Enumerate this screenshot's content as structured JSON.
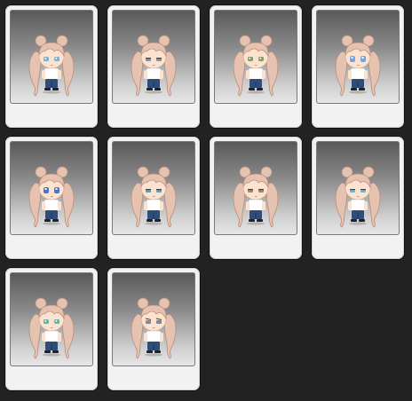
{
  "colors": {
    "background": "#222222",
    "card": "#f2f2f2",
    "hair": "#e6c2b1",
    "hair_shade": "#b88d7c",
    "skin": "#fde3cf",
    "shirt": "#ffffff",
    "pants": "#2f4d7a"
  },
  "faces": [
    {
      "eyes": "#7ab5c9",
      "expression": "neutral"
    },
    {
      "eyes": "#7f95a6",
      "expression": "half-closed"
    },
    {
      "eyes": "#8a9a6e",
      "expression": "neutral"
    },
    {
      "eyes": "#6fa7e0",
      "expression": "wide"
    },
    {
      "eyes": "#4a73c9",
      "expression": "wide"
    },
    {
      "eyes": "#5fa0b8",
      "expression": "sleepy"
    },
    {
      "eyes": "#9a8c6c",
      "expression": "half-closed"
    },
    {
      "eyes": "#6fb6d6",
      "expression": "sleepy"
    },
    {
      "eyes": "#6db2a0",
      "expression": "neutral"
    },
    {
      "eyes": "#7b8aa0",
      "expression": "stern"
    }
  ]
}
